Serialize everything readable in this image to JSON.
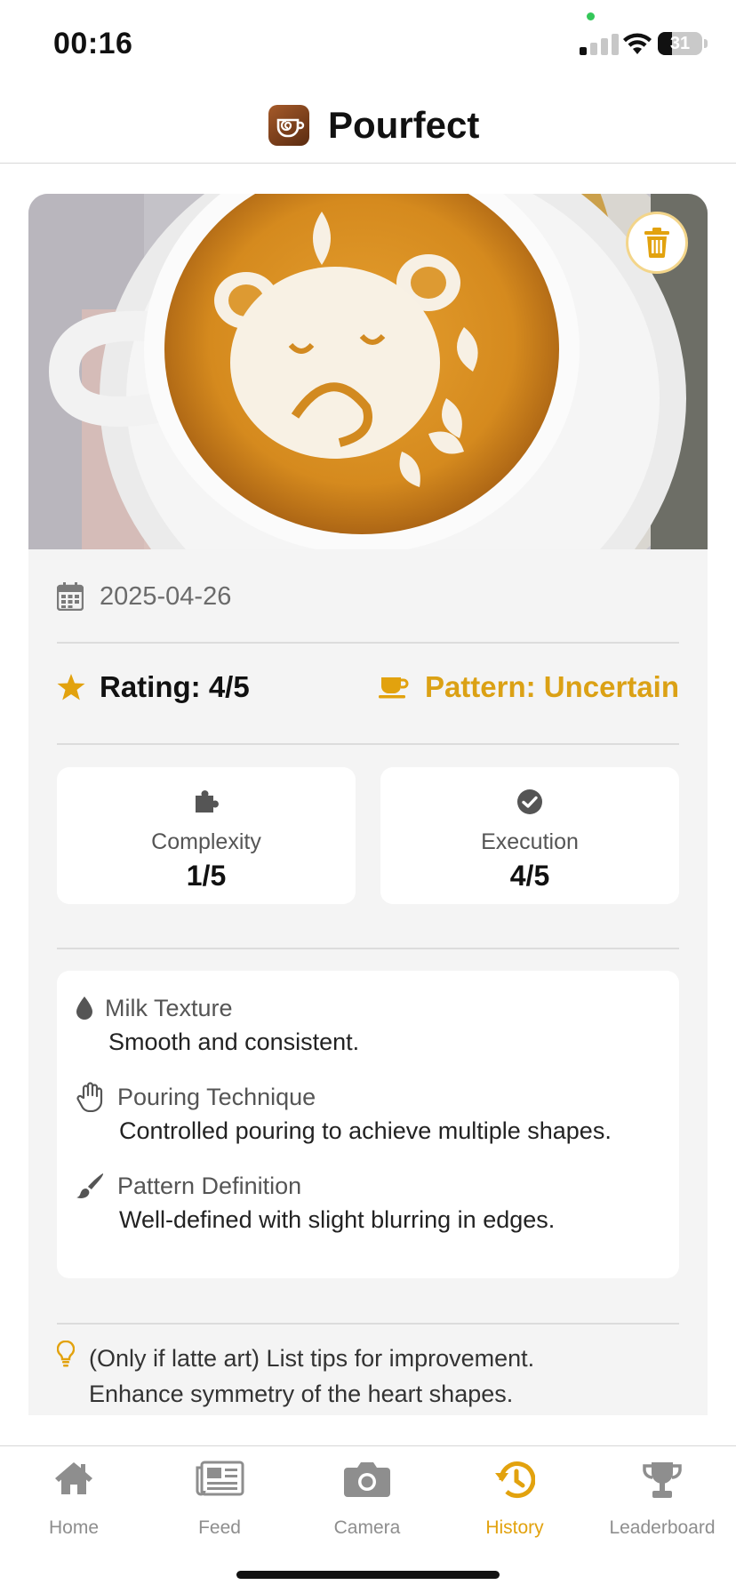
{
  "status_bar": {
    "time": "00:16",
    "battery": "31"
  },
  "app": {
    "title": "Pourfect"
  },
  "entry": {
    "date": "2025-04-26",
    "rating_label": "Rating: 4/5",
    "pattern_label": "Pattern: Uncertain",
    "metrics": [
      {
        "label": "Complexity",
        "value": "1/5",
        "icon": "puzzle-icon"
      },
      {
        "label": "Execution",
        "value": "4/5",
        "icon": "check-circle-icon"
      }
    ],
    "details": [
      {
        "label": "Milk Texture",
        "text": "Smooth and consistent.",
        "icon": "droplet-icon"
      },
      {
        "label": "Pouring Technique",
        "text": "Controlled pouring to achieve multiple shapes.",
        "icon": "hand-icon"
      },
      {
        "label": "Pattern Definition",
        "text": "Well-defined with slight blurring in edges.",
        "icon": "brush-icon"
      }
    ],
    "tip_lines": [
      "(Only if latte art) List tips for improvement.",
      "Enhance symmetry of the heart shapes."
    ]
  },
  "nav": {
    "tabs": [
      {
        "label": "Home",
        "icon": "home-icon"
      },
      {
        "label": "Feed",
        "icon": "newspaper-icon"
      },
      {
        "label": "Camera",
        "icon": "camera-icon"
      },
      {
        "label": "History",
        "icon": "history-icon"
      },
      {
        "label": "Leaderboard",
        "icon": "trophy-icon"
      }
    ],
    "active": "History"
  },
  "colors": {
    "accent": "#e2a20e",
    "pattern": "#dba115",
    "card_bg": "#f4f4f4",
    "inactive": "#8e8e8e"
  }
}
